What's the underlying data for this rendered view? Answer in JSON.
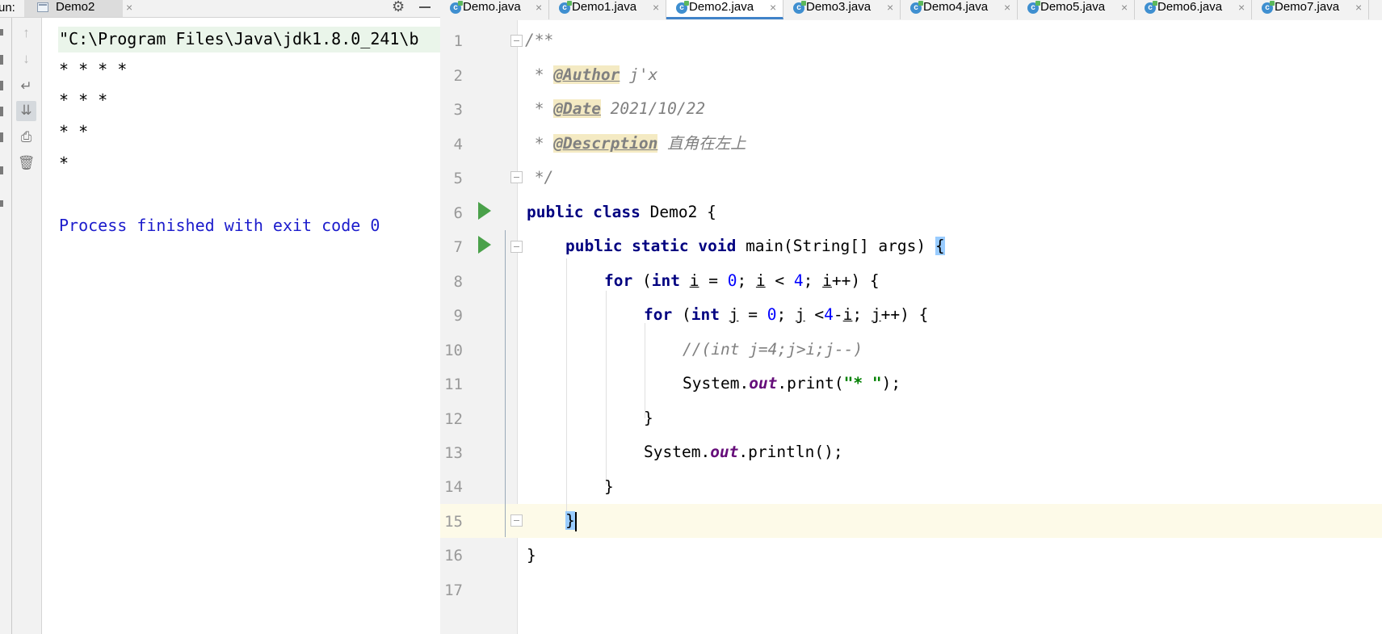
{
  "run_panel": {
    "label": "un:",
    "tab_label": "Demo2",
    "tab_close": "×",
    "settings_icon": "gear-icon",
    "minimize_icon": "minimize-icon",
    "toolbar_icons": [
      "arrow-up-icon",
      "arrow-down-icon",
      "soft-wrap-icon",
      "scroll-to-end-icon",
      "print-icon",
      "trash-icon"
    ],
    "console": {
      "command": "\"C:\\Program Files\\Java\\jdk1.8.0_241\\b",
      "output": [
        "* * * *",
        "* * *",
        "* *",
        "*"
      ],
      "exit_message": "Process finished with exit code 0"
    }
  },
  "editor": {
    "tabs": [
      {
        "label": "Demo.java",
        "close": "×",
        "active": false
      },
      {
        "label": "Demo1.java",
        "close": "×",
        "active": false
      },
      {
        "label": "Demo2.java",
        "close": "×",
        "active": true
      },
      {
        "label": "Demo3.java",
        "close": "×",
        "active": false
      },
      {
        "label": "Demo4.java",
        "close": "×",
        "active": false
      },
      {
        "label": "Demo5.java",
        "close": "×",
        "active": false
      },
      {
        "label": "Demo6.java",
        "close": "×",
        "active": false
      },
      {
        "label": "Demo7.java",
        "close": "×",
        "active": false
      }
    ],
    "tab_icon_letter": "c",
    "line_numbers": [
      "1",
      "2",
      "3",
      "4",
      "5",
      "6",
      "7",
      "8",
      "9",
      "10",
      "11",
      "12",
      "13",
      "14",
      "15",
      "16",
      "17"
    ],
    "current_line": "15",
    "code": {
      "l1": "/**",
      "l2_star": " * ",
      "l2_tag": "@Author",
      "l2_text": " j'x",
      "l3_star": " * ",
      "l3_tag": "@Date",
      "l3_text": " 2021/10/22",
      "l4_star": " * ",
      "l4_tag": "@Descrption",
      "l4_text": " 直角在左上",
      "l5": " */",
      "l6_kw": "public class",
      "l6_rest": " Demo2 {",
      "l7_kw": "public static void",
      "l7_rest": " main(String[] args) ",
      "l7_brace": "{",
      "l8_kw1": "for",
      "l8_p1": " (",
      "l8_kw2": "int",
      "l8_sp": " ",
      "l8_i1": "i",
      "l8_eq": " = ",
      "l8_n0": "0",
      "l8_semi1": "; ",
      "l8_i2": "i",
      "l8_lt": " < ",
      "l8_n4": "4",
      "l8_semi2": "; ",
      "l8_i3": "i",
      "l8_end": "++) {",
      "l9_kw1": "for",
      "l9_p1": " (",
      "l9_kw2": "int",
      "l9_sp": " ",
      "l9_j1": "j",
      "l9_eq": " = ",
      "l9_n0": "0",
      "l9_semi1": "; ",
      "l9_j2": "j",
      "l9_lt": " <",
      "l9_n4": "4",
      "l9_minus": "-",
      "l9_i": "i",
      "l9_semi2": "; ",
      "l9_j3": "j",
      "l9_end": "++) {",
      "l10": "//(int j=4;j>i;j--)",
      "l11_a": "System.",
      "l11_out": "out",
      "l11_b": ".print(",
      "l11_str": "\"* \"",
      "l11_c": ");",
      "l12": "}",
      "l13_a": "System.",
      "l13_out": "out",
      "l13_b": ".println();",
      "l14": "}",
      "l15": "}",
      "l16": "}"
    }
  }
}
